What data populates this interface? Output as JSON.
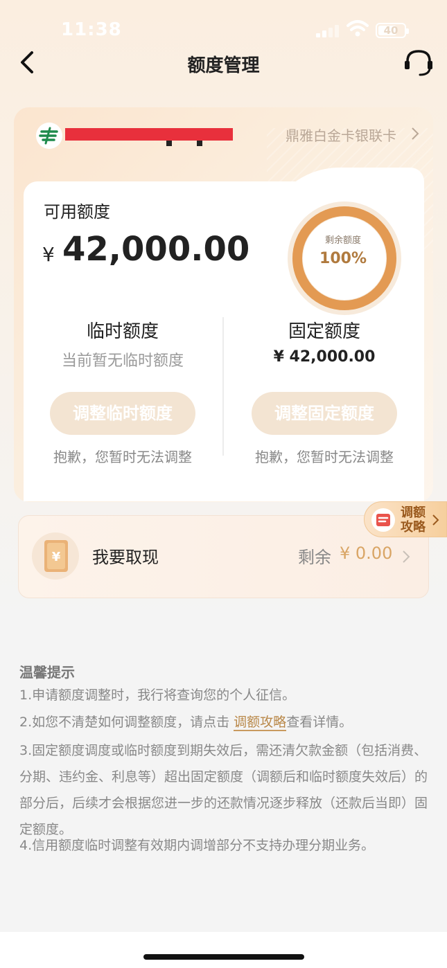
{
  "status_bar": {
    "time": "11:38",
    "battery": "40"
  },
  "nav": {
    "title": "额度管理"
  },
  "card": {
    "type_label": "鼎雅白金卡银联卡"
  },
  "credit": {
    "available_label": "可用额度",
    "currency": "¥",
    "available_amount": "42,000.00",
    "remaining_label": "剩余额度",
    "remaining_pct": "100%",
    "remaining_fraction": 1.0
  },
  "temporary": {
    "title": "临时额度",
    "subtitle": "当前暂无临时额度",
    "button": "调整临时额度",
    "note": "抱歉，您暂时无法调整"
  },
  "fixed": {
    "title": "固定额度",
    "value": "¥ 42,000.00",
    "button": "调整固定额度",
    "note": "抱歉，您暂时无法调整"
  },
  "strategy_tag": {
    "line1": "调额",
    "line2": "攻略"
  },
  "withdraw": {
    "label": "我要取现",
    "remain_label": "剩余",
    "remain_amount": "¥ 0.00"
  },
  "tips": {
    "title": "温馨提示",
    "t1": "1.申请额度调整时，我行将查询您的个人征信。",
    "t2_pre": "2.如您不清楚如何调整额度，请点击 ",
    "t2_link": "调额攻略",
    "t2_post": "查看详情。",
    "t3": "3.固定额度调度或临时额度到期失效后，需还清欠款金额（包括消费、分期、违约金、利息等）超出固定额度（调额后和临时额度失效后）的部分后，后续才会根据您进一步的还款情况逐步释放（还款后当即）固定额度。",
    "t4": "4.信用额度临时调整有效期内调增部分不支持办理分期业务。"
  },
  "colors": {
    "accent": "#b07a3e",
    "ring_outer": "#e39a53",
    "button_bg": "#f3e4d2",
    "redaction": "#e8303c"
  }
}
